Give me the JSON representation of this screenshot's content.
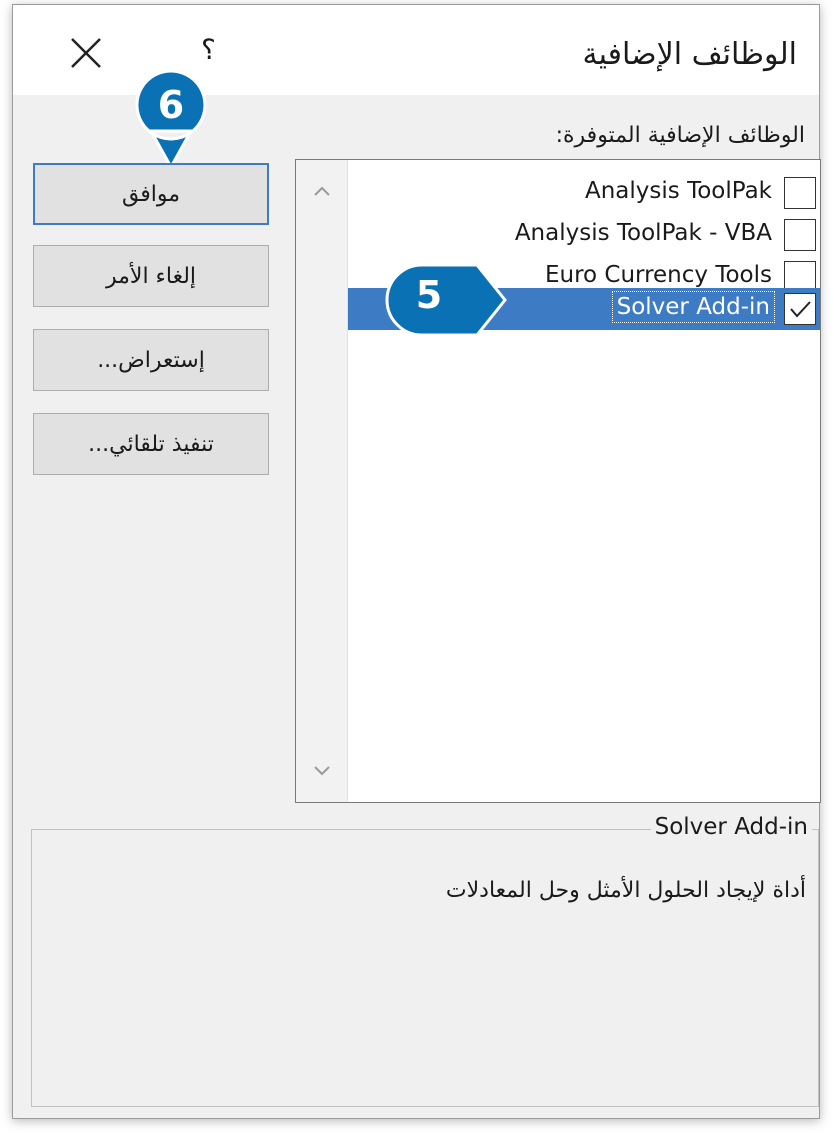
{
  "dialog": {
    "title": "الوظائف الإضافية",
    "help_symbol": "؟"
  },
  "addins": {
    "label": "الوظائف الإضافية المتوفرة:",
    "items": [
      {
        "label": "Analysis ToolPak",
        "checked": false,
        "selected": false
      },
      {
        "label": "Analysis ToolPak - VBA",
        "checked": false,
        "selected": false
      },
      {
        "label": "Euro Currency Tools",
        "checked": false,
        "selected": false
      },
      {
        "label": "Solver Add-in",
        "checked": true,
        "selected": true
      }
    ]
  },
  "buttons": {
    "ok": "موافق",
    "cancel": "إلغاء الأمر",
    "browse": "إستعراض...",
    "automation": "تنفيذ تلقائي..."
  },
  "callouts": {
    "ok_step": "6",
    "select_step": "5",
    "color": "#0a72b4"
  },
  "details": {
    "title": "Solver Add-in",
    "description": "أداة لإيجاد الحلول الأمثل وحل المعادلات"
  },
  "colors": {
    "selection": "#3d7cc4",
    "default_button_border": "#3e7bc4"
  }
}
